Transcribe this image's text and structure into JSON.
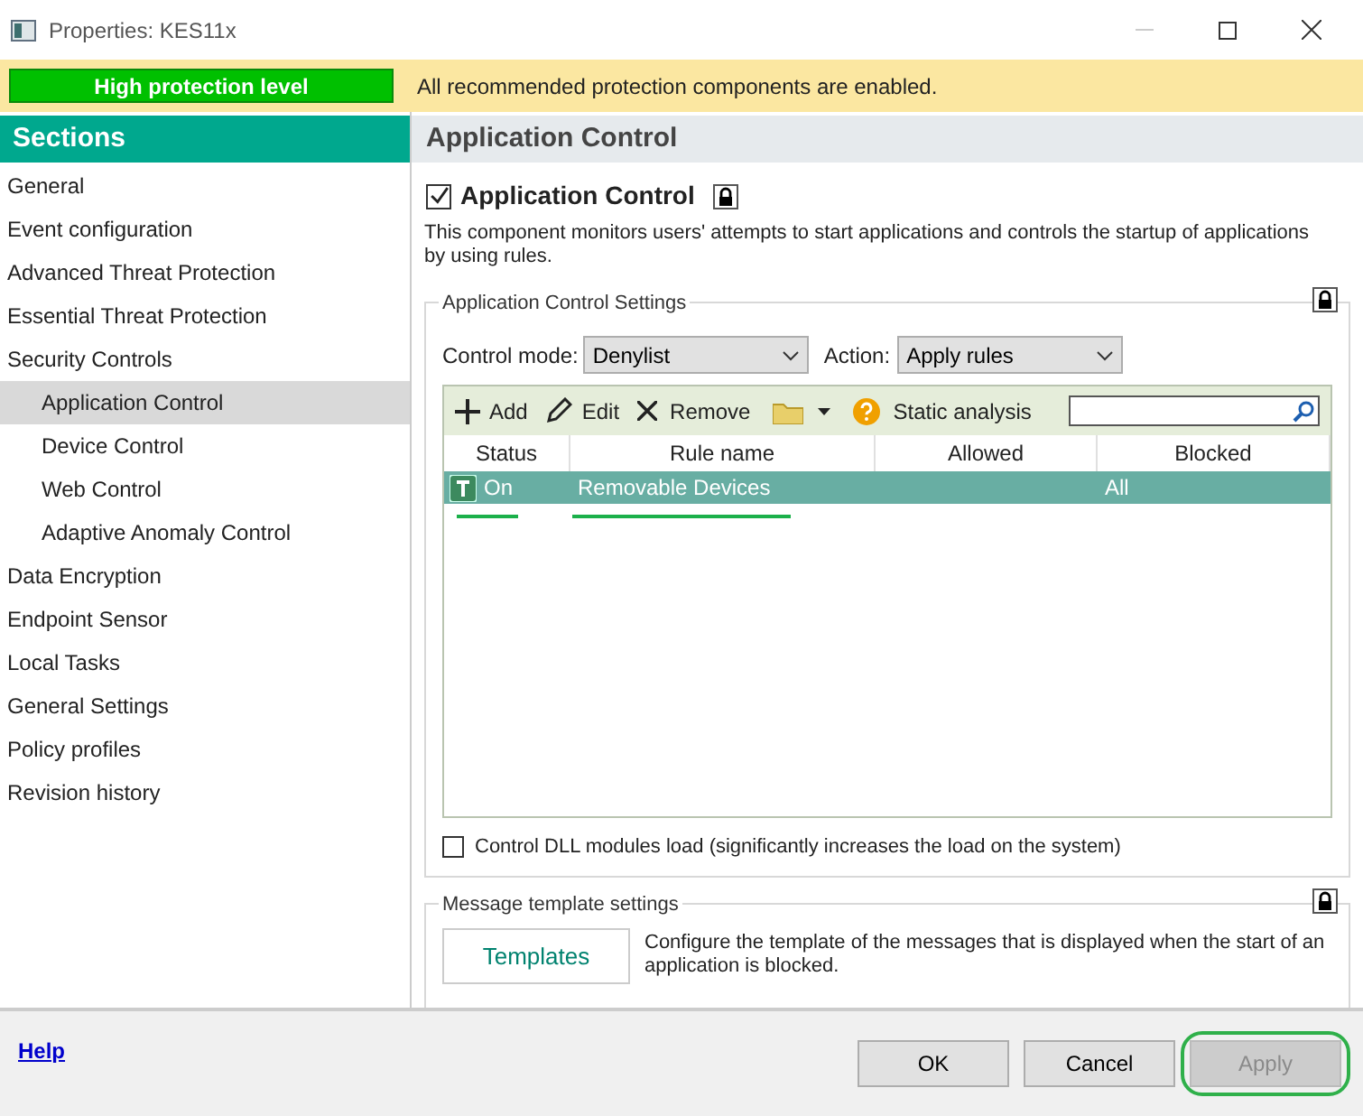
{
  "window": {
    "title": "Properties: KES11x"
  },
  "banner": {
    "level_badge": "High protection level",
    "message": "All recommended protection components are enabled."
  },
  "sidebar": {
    "title": "Sections",
    "items": [
      {
        "label": "General",
        "selected": false
      },
      {
        "label": "Event configuration",
        "selected": false
      },
      {
        "label": "Advanced Threat Protection",
        "selected": false
      },
      {
        "label": "Essential Threat Protection",
        "selected": false
      },
      {
        "label": "Security Controls",
        "selected": false,
        "children": [
          {
            "label": "Application Control",
            "selected": true
          },
          {
            "label": "Device Control",
            "selected": false
          },
          {
            "label": "Web Control",
            "selected": false
          },
          {
            "label": "Adaptive Anomaly Control",
            "selected": false
          }
        ]
      },
      {
        "label": "Data Encryption",
        "selected": false
      },
      {
        "label": "Endpoint Sensor",
        "selected": false
      },
      {
        "label": "Local Tasks",
        "selected": false
      },
      {
        "label": "General Settings",
        "selected": false
      },
      {
        "label": "Policy profiles",
        "selected": false
      },
      {
        "label": "Revision history",
        "selected": false
      }
    ]
  },
  "content": {
    "header": "Application Control",
    "component": {
      "label": "Application Control",
      "checked": true,
      "description": "This component monitors users' attempts to start applications and controls the startup of applications by using rules."
    },
    "settings_group": {
      "title": "Application Control Settings",
      "control_mode": {
        "label": "Control mode:",
        "value": "Denylist"
      },
      "action": {
        "label": "Action:",
        "value": "Apply rules"
      },
      "toolbar": [
        "Add",
        "Edit",
        "Remove",
        "Static analysis"
      ],
      "table": {
        "columns": [
          "Status",
          "Rule name",
          "Allowed",
          "Blocked"
        ],
        "rows": [
          {
            "status": "On",
            "rule_name": "Removable Devices",
            "blocked": "All",
            "selected": true
          }
        ]
      },
      "dll_option": {
        "label": "Control DLL modules load (significantly increases the load on the system)",
        "checked": false
      }
    },
    "template_group": {
      "title": "Message template settings",
      "button": "Templates",
      "description": "Configure the template of the messages that is displayed when the start of an application is blocked."
    }
  },
  "footer": {
    "help": "Help",
    "buttons": [
      {
        "label": "OK",
        "disabled": false
      },
      {
        "label": "Cancel",
        "disabled": false
      },
      {
        "label": "Apply",
        "disabled": true
      }
    ]
  }
}
